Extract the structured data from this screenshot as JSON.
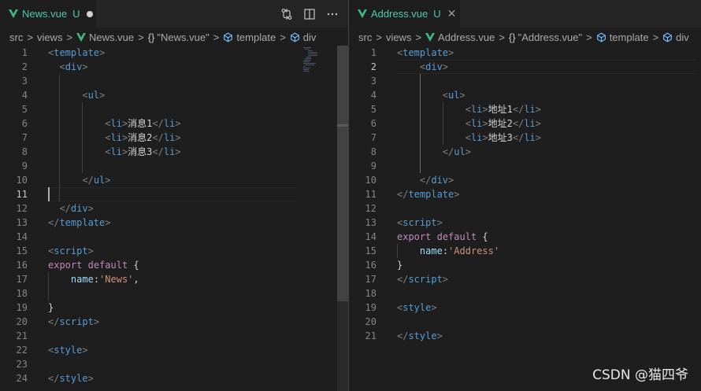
{
  "left": {
    "tab": {
      "name": "News.vue",
      "flag": "U",
      "dirty": true
    },
    "breadcrumb": {
      "src": "src",
      "views": "views",
      "file": "News.vue",
      "component": "\"News.vue\"",
      "template": "template",
      "div": "div"
    },
    "lines": [
      {
        "n": "1",
        "t": [
          [
            "p",
            "<"
          ],
          [
            "g",
            "template"
          ],
          [
            "p",
            ">"
          ]
        ]
      },
      {
        "n": "2",
        "t": [
          [
            "w",
            "  "
          ],
          [
            "p",
            "<"
          ],
          [
            "g",
            "div"
          ],
          [
            "p",
            ">"
          ]
        ]
      },
      {
        "n": "3",
        "t": []
      },
      {
        "n": "4",
        "t": [
          [
            "w",
            "      "
          ],
          [
            "p",
            "<"
          ],
          [
            "g",
            "ul"
          ],
          [
            "p",
            ">"
          ]
        ]
      },
      {
        "n": "5",
        "t": []
      },
      {
        "n": "6",
        "t": [
          [
            "w",
            "          "
          ],
          [
            "p",
            "<"
          ],
          [
            "g",
            "li"
          ],
          [
            "p",
            ">"
          ],
          [
            "x",
            "消息1"
          ],
          [
            "p",
            "</"
          ],
          [
            "g",
            "li"
          ],
          [
            "p",
            ">"
          ]
        ]
      },
      {
        "n": "7",
        "t": [
          [
            "w",
            "          "
          ],
          [
            "p",
            "<"
          ],
          [
            "g",
            "li"
          ],
          [
            "p",
            ">"
          ],
          [
            "x",
            "消息2"
          ],
          [
            "p",
            "</"
          ],
          [
            "g",
            "li"
          ],
          [
            "p",
            ">"
          ]
        ]
      },
      {
        "n": "8",
        "t": [
          [
            "w",
            "          "
          ],
          [
            "p",
            "<"
          ],
          [
            "g",
            "li"
          ],
          [
            "p",
            ">"
          ],
          [
            "x",
            "消息3"
          ],
          [
            "p",
            "</"
          ],
          [
            "g",
            "li"
          ],
          [
            "p",
            ">"
          ]
        ]
      },
      {
        "n": "9",
        "t": []
      },
      {
        "n": "10",
        "t": [
          [
            "w",
            "      "
          ],
          [
            "p",
            "</"
          ],
          [
            "g",
            "ul"
          ],
          [
            "p",
            ">"
          ]
        ]
      },
      {
        "n": "11",
        "t": []
      },
      {
        "n": "12",
        "t": [
          [
            "w",
            "  "
          ],
          [
            "p",
            "</"
          ],
          [
            "g",
            "div"
          ],
          [
            "p",
            ">"
          ]
        ]
      },
      {
        "n": "13",
        "t": [
          [
            "p",
            "</"
          ],
          [
            "g",
            "template"
          ],
          [
            "p",
            ">"
          ]
        ]
      },
      {
        "n": "14",
        "t": []
      },
      {
        "n": "15",
        "t": [
          [
            "p",
            "<"
          ],
          [
            "g",
            "script"
          ],
          [
            "p",
            ">"
          ]
        ]
      },
      {
        "n": "16",
        "t": [
          [
            "k",
            "export"
          ],
          [
            "w",
            " "
          ],
          [
            "k",
            "default"
          ],
          [
            "w",
            " "
          ],
          [
            "x",
            "{"
          ]
        ]
      },
      {
        "n": "17",
        "t": [
          [
            "w",
            "    "
          ],
          [
            "v",
            "name"
          ],
          [
            "x",
            ":"
          ],
          [
            "s",
            "'News'"
          ],
          [
            "x",
            ","
          ]
        ]
      },
      {
        "n": "18",
        "t": []
      },
      {
        "n": "19",
        "t": [
          [
            "x",
            "}"
          ]
        ]
      },
      {
        "n": "20",
        "t": [
          [
            "p",
            "</"
          ],
          [
            "g",
            "script"
          ],
          [
            "p",
            ">"
          ]
        ]
      },
      {
        "n": "21",
        "t": []
      },
      {
        "n": "22",
        "t": [
          [
            "p",
            "<"
          ],
          [
            "g",
            "style"
          ],
          [
            "p",
            ">"
          ]
        ]
      },
      {
        "n": "23",
        "t": []
      },
      {
        "n": "24",
        "t": [
          [
            "p",
            "</"
          ],
          [
            "g",
            "style"
          ],
          [
            "p",
            ">"
          ]
        ]
      }
    ]
  },
  "right": {
    "tab": {
      "name": "Address.vue",
      "flag": "U",
      "dirty": false
    },
    "breadcrumb": {
      "src": "src",
      "views": "views",
      "file": "Address.vue",
      "component": "\"Address.vue\"",
      "template": "template",
      "div": "div"
    },
    "lines": [
      {
        "n": "1",
        "t": [
          [
            "p",
            "<"
          ],
          [
            "g",
            "template"
          ],
          [
            "p",
            ">"
          ]
        ]
      },
      {
        "n": "2",
        "t": [
          [
            "w",
            "    "
          ],
          [
            "p",
            "<"
          ],
          [
            "g",
            "div"
          ],
          [
            "p",
            ">"
          ]
        ]
      },
      {
        "n": "3",
        "t": []
      },
      {
        "n": "4",
        "t": [
          [
            "w",
            "        "
          ],
          [
            "p",
            "<"
          ],
          [
            "g",
            "ul"
          ],
          [
            "p",
            ">"
          ]
        ]
      },
      {
        "n": "5",
        "t": [
          [
            "w",
            "            "
          ],
          [
            "p",
            "<"
          ],
          [
            "g",
            "li"
          ],
          [
            "p",
            ">"
          ],
          [
            "x",
            "地址1"
          ],
          [
            "p",
            "</"
          ],
          [
            "g",
            "li"
          ],
          [
            "p",
            ">"
          ]
        ]
      },
      {
        "n": "6",
        "t": [
          [
            "w",
            "            "
          ],
          [
            "p",
            "<"
          ],
          [
            "g",
            "li"
          ],
          [
            "p",
            ">"
          ],
          [
            "x",
            "地址2"
          ],
          [
            "p",
            "</"
          ],
          [
            "g",
            "li"
          ],
          [
            "p",
            ">"
          ]
        ]
      },
      {
        "n": "7",
        "t": [
          [
            "w",
            "            "
          ],
          [
            "p",
            "<"
          ],
          [
            "g",
            "li"
          ],
          [
            "p",
            ">"
          ],
          [
            "x",
            "地址3"
          ],
          [
            "p",
            "</"
          ],
          [
            "g",
            "li"
          ],
          [
            "p",
            ">"
          ]
        ]
      },
      {
        "n": "8",
        "t": [
          [
            "w",
            "        "
          ],
          [
            "p",
            "</"
          ],
          [
            "g",
            "ul"
          ],
          [
            "p",
            ">"
          ]
        ]
      },
      {
        "n": "9",
        "t": []
      },
      {
        "n": "10",
        "t": [
          [
            "w",
            "    "
          ],
          [
            "p",
            "</"
          ],
          [
            "g",
            "div"
          ],
          [
            "p",
            ">"
          ]
        ]
      },
      {
        "n": "11",
        "t": [
          [
            "p",
            "</"
          ],
          [
            "g",
            "template"
          ],
          [
            "p",
            ">"
          ]
        ]
      },
      {
        "n": "12",
        "t": []
      },
      {
        "n": "13",
        "t": [
          [
            "p",
            "<"
          ],
          [
            "g",
            "script"
          ],
          [
            "p",
            ">"
          ]
        ]
      },
      {
        "n": "14",
        "t": [
          [
            "k",
            "export"
          ],
          [
            "w",
            " "
          ],
          [
            "k",
            "default"
          ],
          [
            "w",
            " "
          ],
          [
            "x",
            "{"
          ]
        ]
      },
      {
        "n": "15",
        "t": [
          [
            "w",
            "    "
          ],
          [
            "v",
            "name"
          ],
          [
            "x",
            ":"
          ],
          [
            "s",
            "'Address'"
          ]
        ]
      },
      {
        "n": "16",
        "t": [
          [
            "x",
            "}"
          ]
        ]
      },
      {
        "n": "17",
        "t": [
          [
            "p",
            "</"
          ],
          [
            "g",
            "script"
          ],
          [
            "p",
            ">"
          ]
        ]
      },
      {
        "n": "18",
        "t": []
      },
      {
        "n": "19",
        "t": [
          [
            "p",
            "<"
          ],
          [
            "g",
            "style"
          ],
          [
            "p",
            ">"
          ]
        ]
      },
      {
        "n": "20",
        "t": []
      },
      {
        "n": "21",
        "t": [
          [
            "p",
            "</"
          ],
          [
            "g",
            "style"
          ],
          [
            "p",
            ">"
          ]
        ]
      }
    ]
  },
  "watermark": "CSDN @猫四爷",
  "colors": {
    "vue_logo": "#42b883",
    "tab_name": "#4ec9b0",
    "tag": "#569cd6",
    "keyword": "#c586c0",
    "property": "#9cdcfe",
    "string": "#ce9178"
  },
  "icons": {
    "tab": "vue-logo-icon",
    "actions": [
      "compare-changes-icon",
      "split-editor-icon",
      "more-actions-icon"
    ],
    "breadcrumb_symbol": "symbol-field-icon"
  }
}
